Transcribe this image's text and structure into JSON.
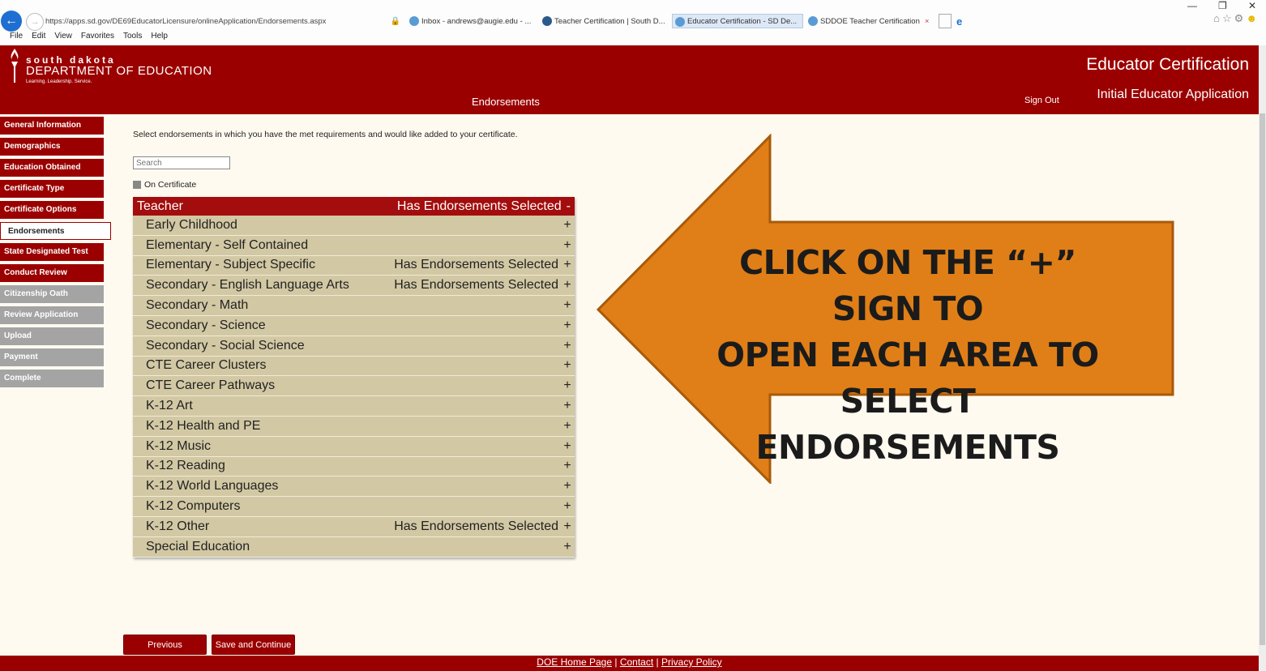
{
  "browser": {
    "address": "https://apps.sd.gov/DE69EducatorLicensure/onlineApplication/Endorsements.aspx",
    "tabs": [
      {
        "label": "Inbox - andrews@augie.edu - ..."
      },
      {
        "label": "Teacher Certification | South D..."
      },
      {
        "label": "Educator Certification - SD De..."
      },
      {
        "label": "SDDOE Teacher Certification"
      }
    ],
    "menu": [
      "File",
      "Edit",
      "View",
      "Favorites",
      "Tools",
      "Help"
    ]
  },
  "header": {
    "logo_top": "south dakota",
    "logo_main": "DEPARTMENT OF EDUCATION",
    "logo_tagline": "Learning. Leadership. Service.",
    "app_title": "Educator Certification",
    "app_subtitle": "Initial Educator Application",
    "page_heading": "Endorsements",
    "sign_out": "Sign Out"
  },
  "sidebar": {
    "items": [
      {
        "label": "General Information",
        "state": "normal"
      },
      {
        "label": "Demographics",
        "state": "normal"
      },
      {
        "label": "Education Obtained",
        "state": "normal"
      },
      {
        "label": "Certificate Type",
        "state": "normal"
      },
      {
        "label": "Certificate Options",
        "state": "normal"
      },
      {
        "label": "Endorsements",
        "state": "active"
      },
      {
        "label": "State Designated Test",
        "state": "normal"
      },
      {
        "label": "Conduct Review",
        "state": "normal"
      },
      {
        "label": "Citizenship Oath",
        "state": "disabled"
      },
      {
        "label": "Review Application",
        "state": "disabled"
      },
      {
        "label": "Upload",
        "state": "disabled"
      },
      {
        "label": "Payment",
        "state": "disabled"
      },
      {
        "label": "Complete",
        "state": "disabled"
      }
    ]
  },
  "main": {
    "instruction": "Select endorsements in which you have the met requirements and would like added to your certificate.",
    "search_placeholder": "Search",
    "on_certificate_label": "On Certificate",
    "category": {
      "label": "Teacher",
      "status": "Has Endorsements Selected",
      "toggle": "-"
    },
    "rows": [
      {
        "label": "Early Childhood",
        "status": "",
        "toggle": "+"
      },
      {
        "label": "Elementary - Self Contained",
        "status": "",
        "toggle": "+"
      },
      {
        "label": "Elementary - Subject Specific",
        "status": "Has Endorsements Selected",
        "toggle": "+"
      },
      {
        "label": "Secondary - English Language Arts",
        "status": "Has Endorsements Selected",
        "toggle": "+"
      },
      {
        "label": "Secondary - Math",
        "status": "",
        "toggle": "+"
      },
      {
        "label": "Secondary - Science",
        "status": "",
        "toggle": "+"
      },
      {
        "label": "Secondary - Social Science",
        "status": "",
        "toggle": "+"
      },
      {
        "label": "CTE Career Clusters",
        "status": "",
        "toggle": "+"
      },
      {
        "label": "CTE Career Pathways",
        "status": "",
        "toggle": "+"
      },
      {
        "label": "K-12 Art",
        "status": "",
        "toggle": "+"
      },
      {
        "label": "K-12 Health and PE",
        "status": "",
        "toggle": "+"
      },
      {
        "label": "K-12 Music",
        "status": "",
        "toggle": "+"
      },
      {
        "label": "K-12 Reading",
        "status": "",
        "toggle": "+"
      },
      {
        "label": "K-12 World Languages",
        "status": "",
        "toggle": "+"
      },
      {
        "label": "K-12 Computers",
        "status": "",
        "toggle": "+"
      },
      {
        "label": "K-12 Other",
        "status": "Has Endorsements Selected",
        "toggle": "+"
      },
      {
        "label": "Special Education",
        "status": "",
        "toggle": "+"
      }
    ],
    "previous_label": "Previous",
    "save_label": "Save and Continue"
  },
  "footer": {
    "home": "DOE Home Page",
    "contact": "Contact",
    "privacy": "Privacy Policy",
    "separator": "|"
  },
  "callout": {
    "lines": [
      "CLICK ON THE “+” SIGN TO",
      "OPEN EACH AREA TO",
      "SELECT ENDORSEMENTS"
    ],
    "fill_color": "#e07f17",
    "stroke_color": "#a85a0a"
  },
  "colors": {
    "brand": "#9b0000",
    "row_bg": "#d2c8a4",
    "content_bg": "#fffaf0"
  }
}
